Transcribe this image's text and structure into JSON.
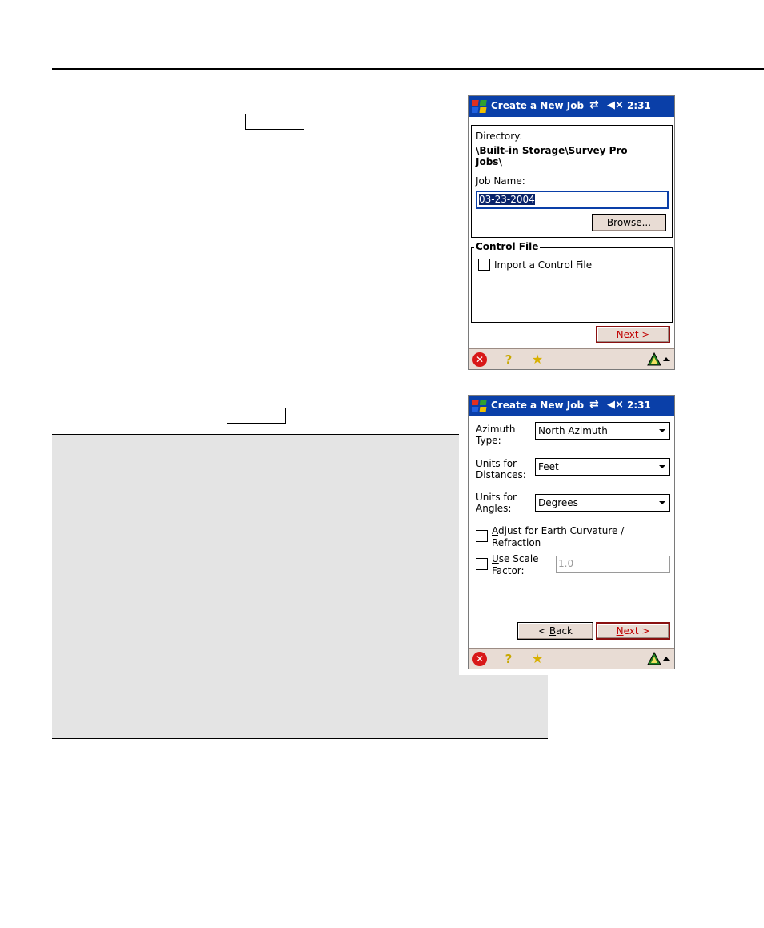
{
  "screen1": {
    "title": "Create a New Job",
    "clock": "2:31",
    "directory_label": "Directory:",
    "directory_line1": "\\Built-in Storage\\Survey Pro",
    "directory_line2": "Jobs\\",
    "job_name_label": "Job Name:",
    "job_name_value": "03-23-2004",
    "browse_label": "rowse...",
    "browse_mnemonic": "B",
    "control_file_legend": "Control File",
    "import_checkbox_label": "Import a Control File",
    "next_mnemonic": "N",
    "next_label": "ext >"
  },
  "screen2": {
    "title": "Create a New Job",
    "clock": "2:31",
    "azimuth_label_1": "Azimuth",
    "azimuth_label_2": "Type:",
    "azimuth_value": "North Azimuth",
    "dist_label_1": "Units for",
    "dist_label_2": "Distances:",
    "dist_value": "Feet",
    "angle_label_1": "Units for",
    "angle_label_2": "Angles:",
    "angle_value": "Degrees",
    "earth_mnemonic": "A",
    "earth_label_1": "djust for Earth Curvature /",
    "earth_label_2": "Refraction",
    "scale_mnemonic": "U",
    "scale_label_1": "se Scale",
    "scale_label_2": "Factor:",
    "scale_value": "1.0",
    "back_prefix": "< ",
    "back_mnemonic": "B",
    "back_label": "ack",
    "next_mnemonic": "N",
    "next_label": "ext >"
  },
  "colors": {
    "titlebar": "#0a3fa8",
    "taskbar": "#e8dcd4",
    "next_text": "#c00000"
  },
  "icons": [
    "windows-start-icon",
    "sync-icon",
    "speaker-mute-icon",
    "close-icon",
    "help-icon",
    "favorites-star-icon",
    "survey-pro-icon",
    "up-arrow-icon"
  ]
}
